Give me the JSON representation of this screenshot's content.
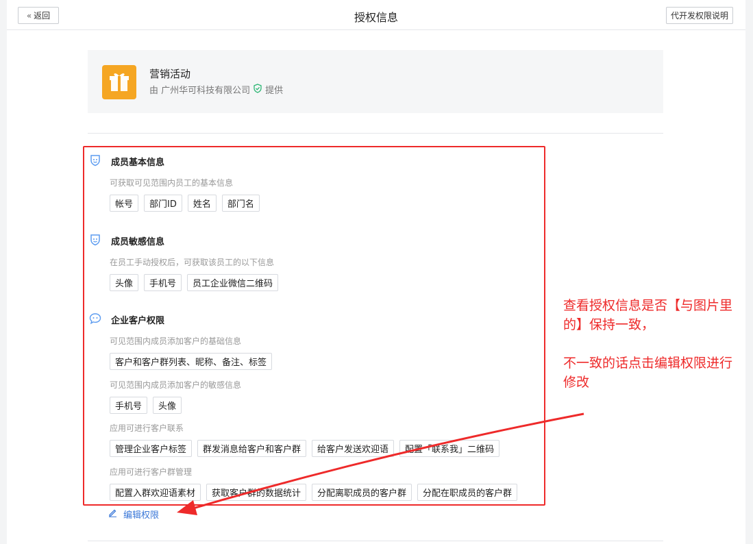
{
  "header": {
    "back_label": "返回",
    "title": "授权信息",
    "permission_doc_label": "代开发权限说明"
  },
  "app": {
    "name": "营销活动",
    "provider_prefix": "由 广州华可科技有限公司",
    "provider_suffix": "提供",
    "logo_color": "#f5a623"
  },
  "sections": [
    {
      "title": "成员基本信息",
      "icon": "shield-icon",
      "groups": [
        {
          "desc": "可获取可见范围内员工的基本信息",
          "tags": [
            "帐号",
            "部门ID",
            "姓名",
            "部门名"
          ]
        }
      ]
    },
    {
      "title": "成员敏感信息",
      "icon": "shield-icon",
      "groups": [
        {
          "desc": "在员工手动授权后，可获取该员工的以下信息",
          "tags": [
            "头像",
            "手机号",
            "员工企业微信二维码"
          ]
        }
      ]
    },
    {
      "title": "企业客户权限",
      "icon": "chat-bubble-icon",
      "groups": [
        {
          "desc": "可见范围内成员添加客户的基础信息",
          "tags": [
            "客户和客户群列表、昵称、备注、标签"
          ]
        },
        {
          "desc": "可见范围内成员添加客户的敏感信息",
          "tags": [
            "手机号",
            "头像"
          ]
        },
        {
          "desc": "应用可进行客户联系",
          "tags": [
            "管理企业客户标签",
            "群发消息给客户和客户群",
            "给客户发送欢迎语",
            "配置「联系我」二维码"
          ]
        },
        {
          "desc": "应用可进行客户群管理",
          "tags": [
            "配置入群欢迎语素材",
            "获取客户群的数据统计",
            "分配离职成员的客户群",
            "分配在职成员的客户群"
          ]
        }
      ]
    }
  ],
  "edit_label": "编辑权限",
  "annotation": {
    "line1": "查看授权信息是否【与图片里的】保持一致，",
    "line2": "不一致的话点击编辑权限进行修改",
    "color": "#ee2a2a"
  },
  "colors": {
    "accent": "#3b78d8",
    "icon_blue": "#5b9bf0",
    "verify_green": "#2bb673"
  }
}
